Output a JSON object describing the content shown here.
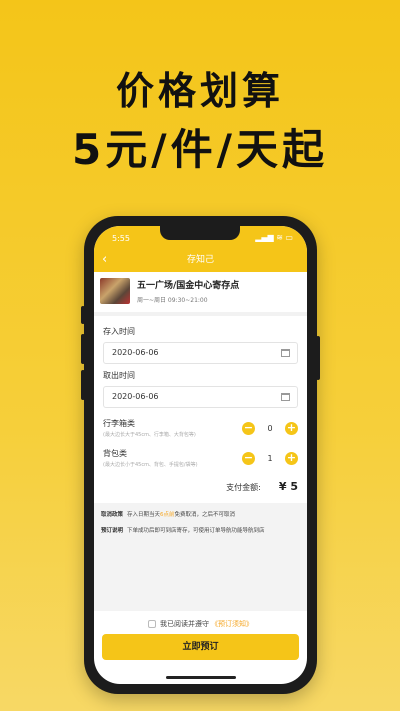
{
  "promo": {
    "headline1": "价格划算",
    "headline2": "5元/件/天起"
  },
  "status_bar": {
    "time": "5:55",
    "icons": "▂▄▆ ≋ ▭"
  },
  "nav": {
    "back_icon": "‹",
    "title": "存知己"
  },
  "store": {
    "name": "五一广场/国金中心寄存点",
    "hours": "周一~周日 09:30~21:00"
  },
  "form": {
    "checkin_label": "存入时间",
    "checkin_date": "2020-06-06",
    "checkout_label": "取出时间",
    "checkout_date": "2020-06-06"
  },
  "items": [
    {
      "title": "行李箱类",
      "desc": "(最大边长大于45cm、行李箱、大背包等)",
      "count": "0"
    },
    {
      "title": "背包类",
      "desc": "(最大边长小于45cm、背包、手提包/袋等)",
      "count": "1"
    }
  ],
  "stepper": {
    "minus": "−",
    "plus": "+"
  },
  "payment": {
    "label": "支付金额:",
    "value": "¥ 5"
  },
  "policy": {
    "cancel_key": "取消政策",
    "cancel_pre": "存入日期当天",
    "cancel_hl": "6点前",
    "cancel_post": "免费取消，之后不可取消",
    "booking_key": "预订说明",
    "booking_text": "下单成功后即可到店寄存，可使用订单导航功能导航到店"
  },
  "agreement": {
    "text": "我已阅读并遵守",
    "link": "《预订须知》"
  },
  "submit_label": "立即预订",
  "colors": {
    "accent": "#f5c518",
    "highlight": "#f5a623"
  }
}
